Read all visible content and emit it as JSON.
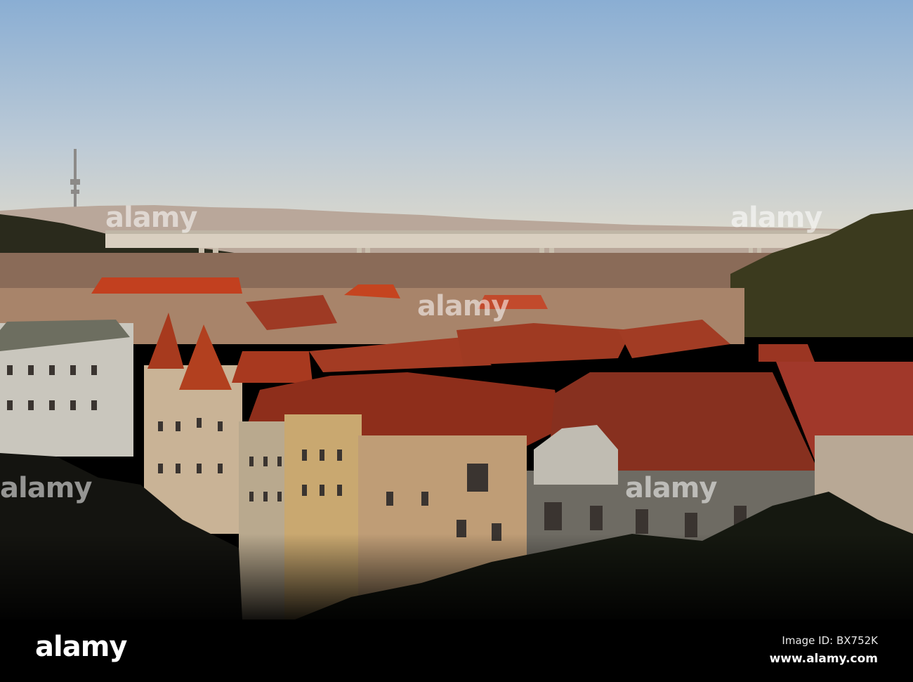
{
  "photo": {
    "subject": "Prague rooftops and Nusle bridge at sunset"
  },
  "watermark": {
    "logo_text": "alamy",
    "image_id": "Image ID: BX752K",
    "url": "www.alamy.com"
  },
  "colors": {
    "sky_top": "#8fb0d3",
    "sky_horizon": "#dcd9cd",
    "roof": "#b8402a",
    "bar": "#000000"
  }
}
